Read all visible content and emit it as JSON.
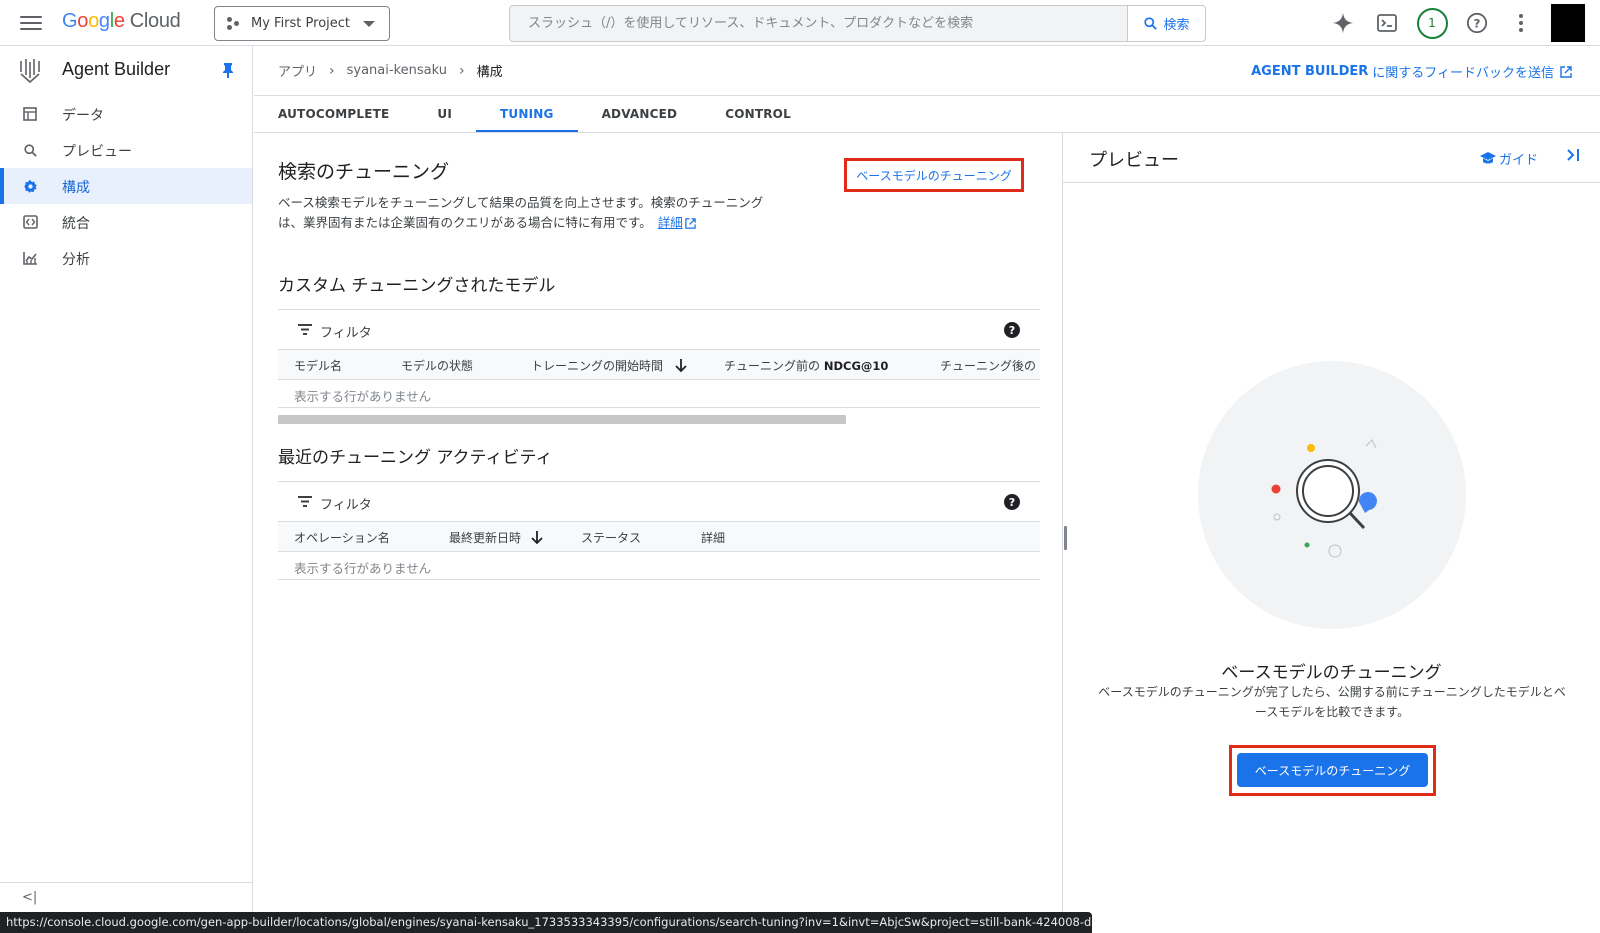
{
  "topbar": {
    "project": "My First Project",
    "search_placeholder": "スラッシュ（/）を使用してリソース、ドキュメント、プロダクトなどを検索",
    "search_button": "検索",
    "notification_count": "1"
  },
  "sidebar": {
    "title": "Agent Builder",
    "items": [
      {
        "label": "データ",
        "icon": "data-table-icon"
      },
      {
        "label": "プレビュー",
        "icon": "search-icon"
      },
      {
        "label": "構成",
        "icon": "gear-icon",
        "active": true
      },
      {
        "label": "統合",
        "icon": "code-icon"
      },
      {
        "label": "分析",
        "icon": "chart-icon"
      }
    ]
  },
  "breadcrumb": {
    "items": [
      "アプリ",
      "syanai-kensaku",
      "構成"
    ]
  },
  "feedback": {
    "bold": "AGENT BUILDER",
    "text": "に関するフィードバックを送信"
  },
  "tabs": [
    {
      "label": "AUTOCOMPLETE"
    },
    {
      "label": "UI"
    },
    {
      "label": "TUNING",
      "active": true
    },
    {
      "label": "ADVANCED"
    },
    {
      "label": "CONTROL"
    }
  ],
  "tuning": {
    "title": "検索のチューニング",
    "base_link": "ベースモデルのチューニング",
    "description": "ベース検索モデルをチューニングして結果の品質を向上させます。検索のチューニングは、業界固有または企業固有のクエリがある場合に特に有用です。",
    "details_link": "詳細"
  },
  "custom_models": {
    "title": "カスタム チューニングされたモデル",
    "filter_label": "フィルタ",
    "columns": [
      "モデル名",
      "モデルの状態",
      "トレーニングの開始時間",
      "チューニング前の",
      "NDCG@10",
      "チューニング後の"
    ],
    "empty": "表示する行がありません"
  },
  "recent_activity": {
    "title": "最近のチューニング アクティビティ",
    "filter_label": "フィルタ",
    "columns": [
      "オペレーション名",
      "最終更新日時",
      "ステータス",
      "詳細"
    ],
    "empty": "表示する行がありません"
  },
  "preview": {
    "title": "プレビュー",
    "guide": "ガイド",
    "heading": "ベースモデルのチューニング",
    "description": "ベースモデルのチューニングが完了したら、公開する前にチューニングしたモデルとベースモデルを比較できます。",
    "cta": "ベースモデルのチューニング"
  },
  "status_url": "https://console.cloud.google.com/gen-app-builder/locations/global/engines/syanai-kensaku_1733533343395/configurations/search-tuning?inv=1&invt=AbjcSw&project=still-bank-424008-d6",
  "colors": {
    "accent": "#1a73e8",
    "highlight": "#e02b18"
  }
}
